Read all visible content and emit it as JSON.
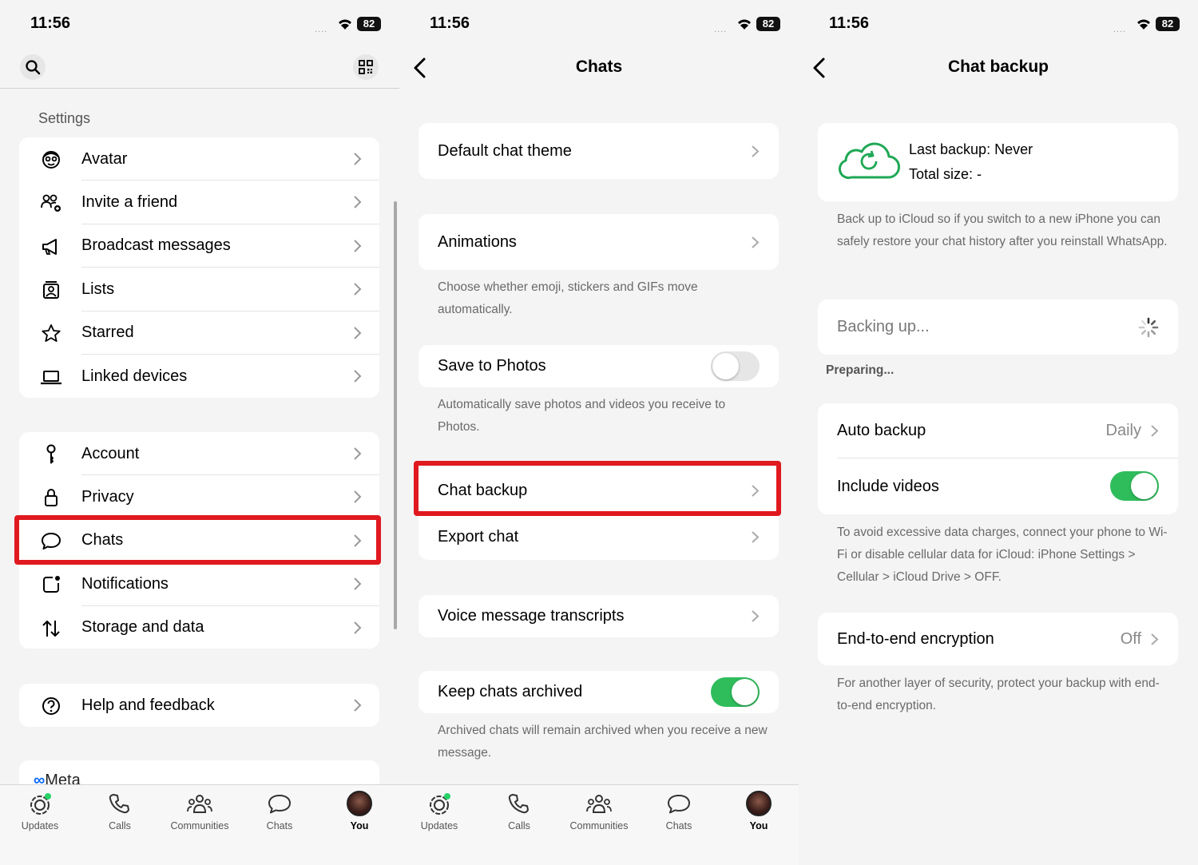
{
  "status": {
    "time": "11:56",
    "signal": "....",
    "battery": "82"
  },
  "settings": {
    "section_title": "Settings",
    "group1": [
      "Avatar",
      "Invite a friend",
      "Broadcast messages",
      "Lists",
      "Starred",
      "Linked devices"
    ],
    "group2": [
      "Account",
      "Privacy",
      "Chats",
      "Notifications",
      "Storage and data"
    ],
    "group3": [
      "Help and feedback"
    ],
    "meta": "Meta"
  },
  "tabs": [
    "Updates",
    "Calls",
    "Communities",
    "Chats",
    "You"
  ],
  "chats": {
    "title": "Chats",
    "default_theme": "Default chat theme",
    "animations": "Animations",
    "animations_note": "Choose whether emoji, stickers and GIFs move automatically.",
    "save_photos": "Save to Photos",
    "save_photos_note": "Automatically save photos and videos you receive to Photos.",
    "chat_backup": "Chat backup",
    "export_chat": "Export chat",
    "voice_transcripts": "Voice message transcripts",
    "keep_archived": "Keep chats archived",
    "keep_archived_note": "Archived chats will remain archived when you receive a new message."
  },
  "backup": {
    "title": "Chat backup",
    "last_backup": "Last backup: Never",
    "total_size": "Total size: -",
    "icloud_note": "Back up to iCloud so if you switch to a new iPhone you can safely restore your chat history after you reinstall WhatsApp.",
    "backing_up": "Backing up...",
    "preparing": "Preparing...",
    "auto_backup": "Auto backup",
    "auto_backup_value": "Daily",
    "include_videos": "Include videos",
    "data_note": "To avoid excessive data charges, connect your phone to Wi-Fi or disable cellular data for iCloud: iPhone Settings > Cellular > iCloud Drive > OFF.",
    "e2e": "End-to-end encryption",
    "e2e_value": "Off",
    "e2e_note": "For another layer of security, protect your backup with end-to-end encryption."
  },
  "colors": {
    "highlight": "#e0191f",
    "toggle_on": "#2fbd5c",
    "cloud": "#1fa855"
  },
  "icons": [
    "search-icon",
    "qr-code-icon",
    "avatar-icon",
    "invite-friend-icon",
    "megaphone-icon",
    "lists-icon",
    "star-icon",
    "laptop-icon",
    "key-icon",
    "lock-icon",
    "chat-bubble-icon",
    "notification-icon",
    "arrows-updown-icon",
    "help-icon",
    "chevron-right-icon",
    "back-chevron-icon",
    "cloud-sync-icon",
    "spinner-icon"
  ]
}
